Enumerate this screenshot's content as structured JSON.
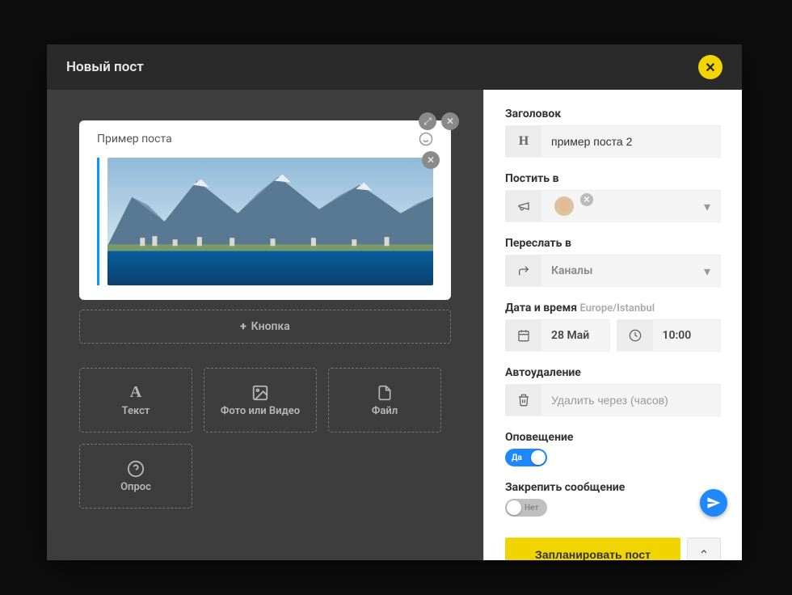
{
  "modal": {
    "title": "Новый пост"
  },
  "post": {
    "caption": "Пример поста"
  },
  "buttons": {
    "add_button": "Кнопка"
  },
  "attach": {
    "text": "Текст",
    "media": "Фото или Видео",
    "file": "Файл",
    "poll": "Опрос"
  },
  "sidebar": {
    "title_label": "Заголовок",
    "title_value": "пример поста 2",
    "post_to_label": "Постить в",
    "forward_to_label": "Переслать в",
    "forward_to_placeholder": "Каналы",
    "datetime_label": "Дата и время",
    "timezone": "Europe/Istanbul",
    "date_value": "28 Май",
    "time_value": "10:00",
    "autodelete_label": "Автоудаление",
    "autodelete_placeholder": "Удалить через (часов)",
    "notify_label": "Оповещение",
    "notify_on": "Да",
    "pin_label": "Закрепить сообщение",
    "pin_off": "Нет",
    "submit": "Запланировать пост"
  }
}
